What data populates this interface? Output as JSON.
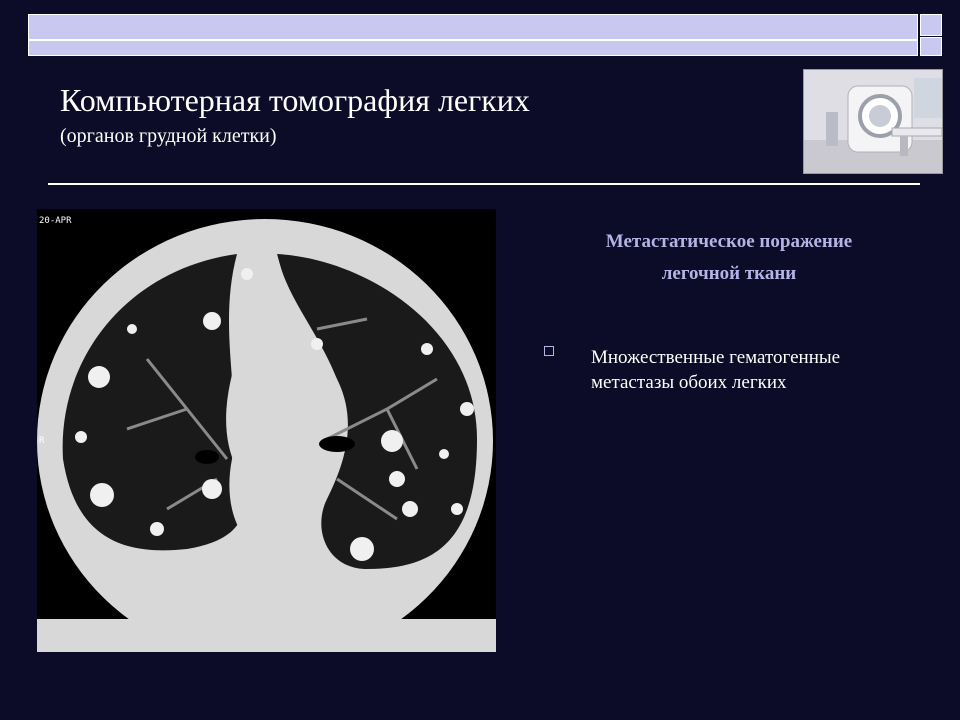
{
  "slide": {
    "title": "Компьютерная томография легких",
    "subtitle": "(органов грудной клетки)",
    "heading_line1": "Метастатическое поражение",
    "heading_line2": "легочной ткани",
    "bullet_text_line1": "Множественные гематогенные",
    "bullet_text_line2": "метастазы обоих легких",
    "ct_label_top": "20-APR",
    "ct_label_side": "R"
  },
  "colors": {
    "background": "#0c0c28",
    "accent": "#b4b4e6",
    "bar": "#c8c8f0"
  }
}
